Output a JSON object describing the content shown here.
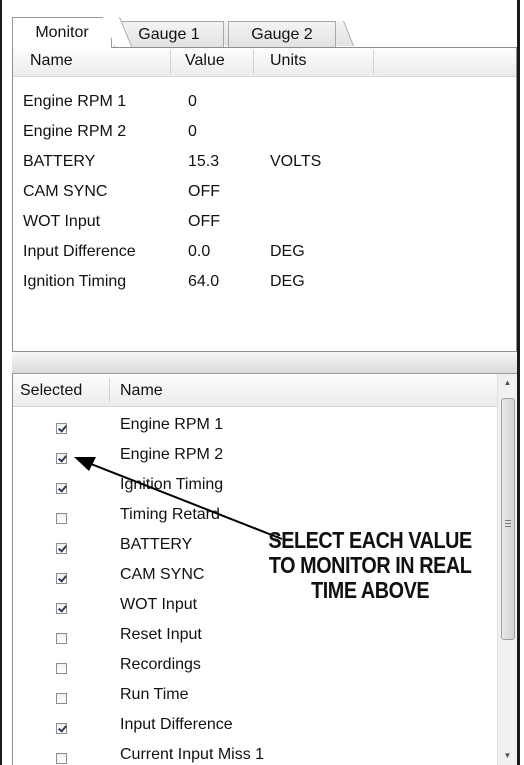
{
  "tabs": [
    {
      "label": "Monitor",
      "active": true
    },
    {
      "label": "Gauge 1",
      "active": false
    },
    {
      "label": "Gauge 2",
      "active": false
    }
  ],
  "monitor": {
    "columns": [
      "Name",
      "Value",
      "Units"
    ],
    "rows": [
      {
        "name": "Engine RPM 1",
        "value": "0",
        "units": ""
      },
      {
        "name": "Engine RPM 2",
        "value": "0",
        "units": ""
      },
      {
        "name": "BATTERY",
        "value": "15.3",
        "units": "VOLTS"
      },
      {
        "name": "CAM SYNC",
        "value": "OFF",
        "units": ""
      },
      {
        "name": "WOT Input",
        "value": "OFF",
        "units": ""
      },
      {
        "name": "Input Difference",
        "value": "0.0",
        "units": "DEG"
      },
      {
        "name": "Ignition Timing",
        "value": "64.0",
        "units": "DEG"
      }
    ]
  },
  "selection": {
    "columns": [
      "Selected",
      "Name"
    ],
    "rows": [
      {
        "name": "Engine RPM 1",
        "checked": true
      },
      {
        "name": "Engine RPM 2",
        "checked": true
      },
      {
        "name": "Ignition Timing",
        "checked": true
      },
      {
        "name": "Timing Retard",
        "checked": false
      },
      {
        "name": "BATTERY",
        "checked": true
      },
      {
        "name": "CAM SYNC",
        "checked": true
      },
      {
        "name": "WOT Input",
        "checked": true
      },
      {
        "name": "Reset Input",
        "checked": false
      },
      {
        "name": "Recordings",
        "checked": false
      },
      {
        "name": "Run Time",
        "checked": false
      },
      {
        "name": "Input Difference",
        "checked": true
      },
      {
        "name": "Current Input Miss 1",
        "checked": false
      }
    ]
  },
  "annotation": {
    "lines": [
      "SELECT EACH VALUE",
      "TO MONITOR IN REAL",
      "TIME ABOVE"
    ]
  },
  "icons": {
    "scroll_up": "triangle-up-icon",
    "scroll_down": "triangle-down-icon",
    "thumb_grip": "grip-icon"
  }
}
